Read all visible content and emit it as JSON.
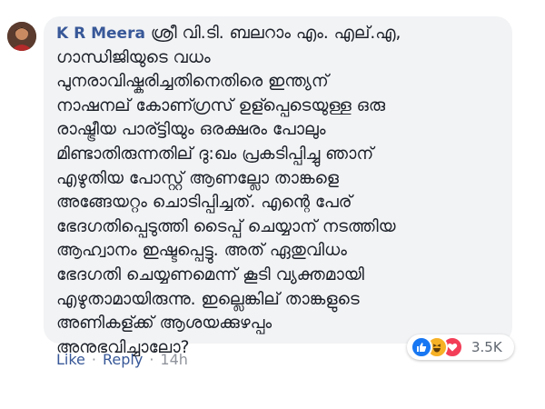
{
  "comment": {
    "author": "K R Meera",
    "lines": [
      "ശ്രീ വി.ടി. ബലറാം എം. എല്.എ,",
      "ഗാന്ധിജിയുടെ വധം",
      "പുനരാവിഷ്കരിച്ചതിനെതിരെ ഇന്ത്യന്",
      "നാഷനല് കോണ്ഗ്രസ് ഉള്പ്പെടെയുള്ള ഒരു",
      "രാഷ്ട്രീയ പാര്ട്ടിയും ഒരക്ഷരം പോലും",
      "മിണ്ടാതിരുന്നതില് ദു:ഖം പ്രകടിപ്പിച്ചു ഞാന്",
      "എഴുതിയ പോസ്റ്റ് ആണല്ലോ താങ്കളെ",
      "അങ്ങേയറ്റം ചൊടിപ്പിച്ചത്. എന്റെ പേര്",
      "ഭേദഗതിപ്പെടുത്തി ടൈപ്പ് ചെയ്യാന് നടത്തിയ",
      "ആഹ്വാനം ഇഷ്ടപ്പെട്ടു. അത് ഏതുവിധം",
      "ഭേദഗതി ചെയ്യണമെന്ന് കൂടി വ്യക്തമായി",
      "എഴുതാമായിരുന്നു. ഇല്ലെങ്കില് താങ്കളുടെ",
      "അണികള്ക്ക് ആശയക്കുഴപ്പം",
      "അനുഭവിച്ചാലോ?"
    ],
    "reactions": {
      "icons": [
        "like-icon",
        "haha-icon",
        "love-icon"
      ],
      "count": "3.5K"
    },
    "actions": {
      "like": "Like",
      "separator": "·",
      "reply": "Reply",
      "time": "14h"
    }
  },
  "colors": {
    "author": "#385898",
    "bubble": "#f2f3f5",
    "like": "#1877f2",
    "haha": "#f7b125",
    "love": "#f33e58",
    "meta": "#90949c"
  }
}
